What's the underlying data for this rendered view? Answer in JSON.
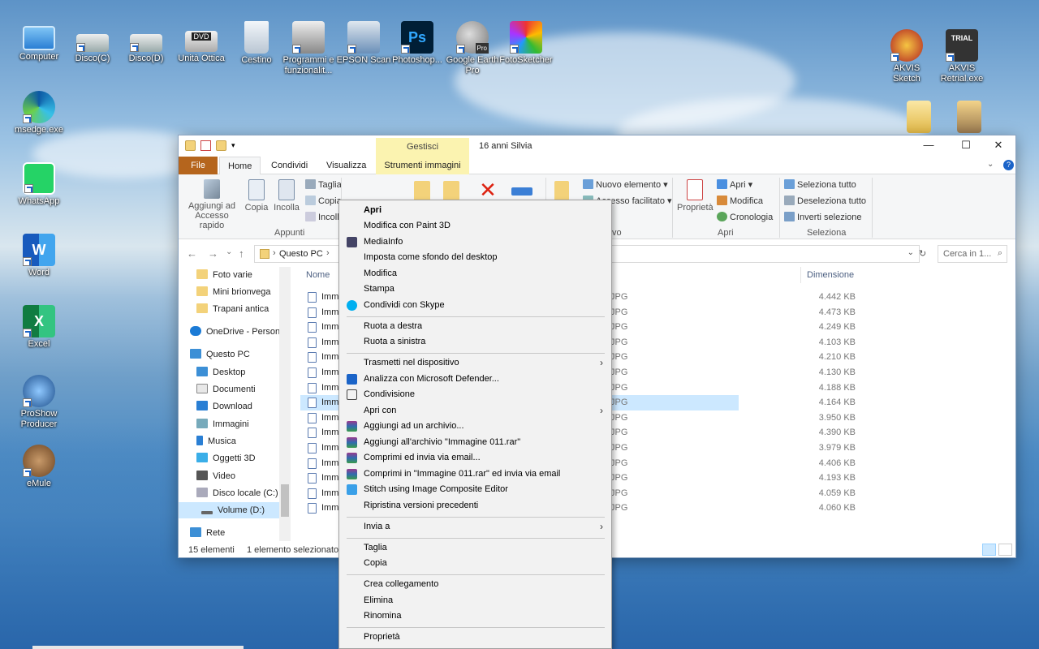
{
  "desktop": {
    "icons": [
      {
        "label": "Computer"
      },
      {
        "label": "Disco(C)"
      },
      {
        "label": "Disco(D)"
      },
      {
        "label": "Unità Ottica"
      },
      {
        "label": "Cestino"
      },
      {
        "label": "Programmi e funzionalit..."
      },
      {
        "label": "EPSON Scan"
      },
      {
        "label": "Photoshop..."
      },
      {
        "label": "Google Earth Pro"
      },
      {
        "label": "FotoSketcher"
      },
      {
        "label": "AKVIS Sketch"
      },
      {
        "label": "AKVIS Retrial.exe"
      },
      {
        "label": "msedge.exe"
      },
      {
        "label": "WhatsApp"
      },
      {
        "label": "Word"
      },
      {
        "label": "Excel"
      },
      {
        "label": "ProShow Producer"
      },
      {
        "label": "eMule"
      }
    ],
    "dvd_badge": "DVD",
    "ps_badge": "Ps",
    "pro_badge": "Pro",
    "w_badge": "W",
    "x_badge": "X",
    "trial_badge": "TRIAL"
  },
  "window": {
    "title": "16 anni Silvia",
    "context_group": "Gestisci",
    "minimize": "—",
    "maximize": "☐",
    "close": "✕",
    "tabs": {
      "file": "File",
      "home": "Home",
      "share": "Condividi",
      "view": "Visualizza",
      "tools": "Strumenti immagini"
    },
    "ribbon": {
      "pin": "Aggiungi ad Accesso rapido",
      "copy": "Copia",
      "paste": "Incolla",
      "cut": "Taglia",
      "copy_path": "Copia",
      "paste_link": "Incoll",
      "new_item": "Nuovo elemento ▾",
      "easy_access": "Accesso facilitato ▾",
      "properties": "Proprietà",
      "open": "Apri ▾",
      "edit": "Modifica",
      "history": "Cronologia",
      "select_all": "Seleziona tutto",
      "select_none": "Deseleziona tutto",
      "invert": "Inverti selezione",
      "group_clipboard": "Appunti",
      "group_new": "vo",
      "group_open": "Apri",
      "group_select": "Seleziona"
    },
    "address": {
      "crumb": "Questo PC",
      "search_placeholder": "Cerca in 1..."
    },
    "nav": [
      {
        "label": "Foto varie"
      },
      {
        "label": "Mini brionvega"
      },
      {
        "label": "Trapani antica"
      },
      {
        "label": "OneDrive - Person"
      },
      {
        "label": "Questo PC"
      },
      {
        "label": "Desktop"
      },
      {
        "label": "Documenti"
      },
      {
        "label": "Download"
      },
      {
        "label": "Immagini"
      },
      {
        "label": "Musica"
      },
      {
        "label": "Oggetti 3D"
      },
      {
        "label": "Video"
      },
      {
        "label": "Disco locale (C:)"
      },
      {
        "label": "Volume (D:)"
      },
      {
        "label": "Rete"
      }
    ],
    "columns": {
      "name": "Nome",
      "size": "Dimensione"
    },
    "files": [
      {
        "name": "Imm",
        "type": "JPG",
        "size": "4.442 KB"
      },
      {
        "name": "Imm",
        "type": "JPG",
        "size": "4.473 KB"
      },
      {
        "name": "Imm",
        "type": "JPG",
        "size": "4.249 KB"
      },
      {
        "name": "Imm",
        "type": "JPG",
        "size": "4.103 KB"
      },
      {
        "name": "Imm",
        "type": "JPG",
        "size": "4.210 KB"
      },
      {
        "name": "Imm",
        "type": "JPG",
        "size": "4.130 KB"
      },
      {
        "name": "Imm",
        "type": "JPG",
        "size": "4.188 KB"
      },
      {
        "name": "Imm",
        "type": "JPG",
        "size": "4.164 KB"
      },
      {
        "name": "Imm",
        "type": "JPG",
        "size": "3.950 KB"
      },
      {
        "name": "Imm",
        "type": "JPG",
        "size": "4.390 KB"
      },
      {
        "name": "Imm",
        "type": "JPG",
        "size": "3.979 KB"
      },
      {
        "name": "Imm",
        "type": "JPG",
        "size": "4.406 KB"
      },
      {
        "name": "Imm",
        "type": "JPG",
        "size": "4.193 KB"
      },
      {
        "name": "Imm",
        "type": "JPG",
        "size": "4.059 KB"
      },
      {
        "name": "Imm",
        "type": "JPG",
        "size": "4.060 KB"
      }
    ],
    "status": {
      "count": "15 elementi",
      "selected": "1 elemento selezionato"
    }
  },
  "context_menu": {
    "items": [
      {
        "label": "Apri"
      },
      {
        "label": "Modifica con Paint 3D"
      },
      {
        "label": "MediaInfo"
      },
      {
        "label": "Imposta come sfondo del desktop"
      },
      {
        "label": "Modifica"
      },
      {
        "label": "Stampa"
      },
      {
        "label": "Condividi con Skype"
      },
      {
        "label": "Ruota a destra"
      },
      {
        "label": "Ruota a sinistra"
      },
      {
        "label": "Trasmetti nel dispositivo"
      },
      {
        "label": "Analizza con Microsoft Defender..."
      },
      {
        "label": "Condivisione"
      },
      {
        "label": "Apri con"
      },
      {
        "label": "Aggiungi ad un archivio..."
      },
      {
        "label": "Aggiungi all'archivio \"Immagine 011.rar\""
      },
      {
        "label": "Comprimi ed invia via email..."
      },
      {
        "label": "Comprimi in \"Immagine 011.rar\" ed invia via email"
      },
      {
        "label": "Stitch using Image Composite Editor"
      },
      {
        "label": "Ripristina versioni precedenti"
      },
      {
        "label": "Invia a"
      },
      {
        "label": "Taglia"
      },
      {
        "label": "Copia"
      },
      {
        "label": "Crea collegamento"
      },
      {
        "label": "Elimina"
      },
      {
        "label": "Rinomina"
      },
      {
        "label": "Proprietà"
      }
    ],
    "submenu_arrow": "›"
  },
  "colors": {
    "selection": "#cce8ff",
    "file_tab": "#b5651d",
    "context_tab": "#fbf3b0",
    "menu_bg": "#f2f2f2"
  }
}
